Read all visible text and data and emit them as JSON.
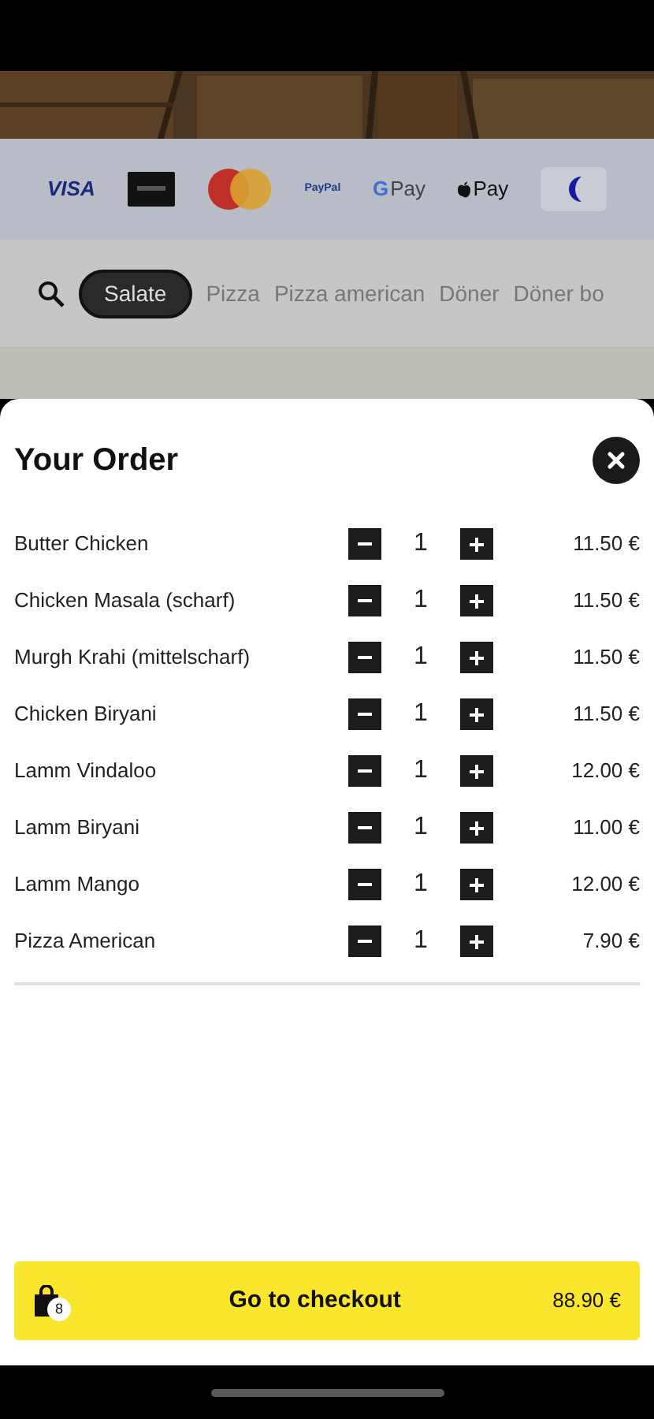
{
  "payment_methods": [
    {
      "kind": "visa",
      "label": "VISA"
    },
    {
      "kind": "card"
    },
    {
      "kind": "mastercard"
    },
    {
      "kind": "paypal",
      "label": "PayPal"
    },
    {
      "kind": "gpay",
      "mark": "G",
      "label": "Pay"
    },
    {
      "kind": "applepay",
      "label": "Pay"
    },
    {
      "kind": "other"
    }
  ],
  "categories": [
    {
      "label": "Salate",
      "selected": true
    },
    {
      "label": "Pizza",
      "selected": false
    },
    {
      "label": "Pizza american",
      "selected": false
    },
    {
      "label": "Döner",
      "selected": false
    },
    {
      "label": "Döner bo",
      "selected": false
    }
  ],
  "order": {
    "title": "Your Order",
    "items": [
      {
        "name": "Butter Chicken",
        "quantity": "1",
        "price": "11.50 €"
      },
      {
        "name": "Chicken Masala (scharf)",
        "quantity": "1",
        "price": "11.50 €"
      },
      {
        "name": "Murgh Krahi (mittelscharf)",
        "quantity": "1",
        "price": "11.50 €"
      },
      {
        "name": "Chicken Biryani",
        "quantity": "1",
        "price": "11.50 €"
      },
      {
        "name": "Lamm Vindaloo",
        "quantity": "1",
        "price": "12.00 €"
      },
      {
        "name": "Lamm Biryani",
        "quantity": "1",
        "price": "11.00 €"
      },
      {
        "name": "Lamm Mango",
        "quantity": "1",
        "price": "12.00 €"
      },
      {
        "name": "Pizza American",
        "quantity": "1",
        "price": "7.90 €"
      }
    ],
    "checkout": {
      "label": "Go to checkout",
      "count": "8",
      "total": "88.90 €"
    }
  }
}
